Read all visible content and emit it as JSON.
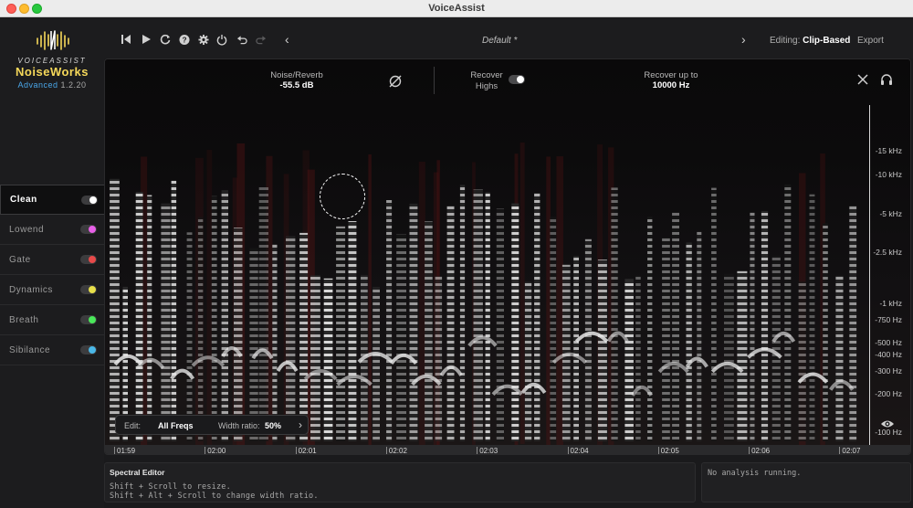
{
  "window": {
    "title": "VoiceAssist"
  },
  "brand": {
    "company": "VOICEASSIST",
    "product": "NoiseWorks",
    "edition": "Advanced",
    "version": "1.2.20"
  },
  "modules": [
    {
      "label": "Clean",
      "active": true,
      "dot": "#ffffff"
    },
    {
      "label": "Lowend",
      "active": false,
      "dot": "#e860e8"
    },
    {
      "label": "Gate",
      "active": false,
      "dot": "#e84a4a"
    },
    {
      "label": "Dynamics",
      "active": false,
      "dot": "#e8e04a"
    },
    {
      "label": "Breath",
      "active": false,
      "dot": "#4ae85a"
    },
    {
      "label": "Sibilance",
      "active": false,
      "dot": "#4ab8e8"
    }
  ],
  "toolbar": {
    "icons": [
      "skip-back-icon",
      "play-icon",
      "loop-icon",
      "help-icon",
      "settings-icon",
      "power-icon",
      "undo-icon",
      "redo-icon"
    ],
    "preset": "Default *",
    "editing_label": "Editing:",
    "editing_mode": "Clip-Based",
    "export_label": "Export"
  },
  "controls": {
    "noise_reverb_label": "Noise/Reverb",
    "noise_reverb_value": "-55.5 dB",
    "recover_highs_label_1": "Recover",
    "recover_highs_label_2": "Highs",
    "recover_highs_on": true,
    "recover_up_to_label": "Recover up to",
    "recover_up_to_value": "10000 Hz"
  },
  "freq_axis": [
    "-15 kHz",
    "-10 kHz",
    "-5 kHz",
    "-2.5 kHz",
    "-1 kHz",
    "-750 Hz",
    "-500 Hz",
    "-400 Hz",
    "-300 Hz",
    "-200 Hz",
    "-100 Hz"
  ],
  "edit_bar": {
    "edit_label": "Edit:",
    "edit_value": "All Freqs",
    "width_label": "Width ratio:",
    "width_value": "50%"
  },
  "timeline": [
    "01:59",
    "02:00",
    "02:01",
    "02:02",
    "02:03",
    "02:04",
    "02:05",
    "02:06",
    "02:07"
  ],
  "spectral_editor": {
    "title": "Spectral Editor",
    "line1": "Shift + Scroll to resize.",
    "line2": "Shift + Alt + Scroll to change width ratio."
  },
  "analysis": {
    "status": "No analysis running."
  },
  "colors": {
    "accent_yellow": "#f6d85a",
    "accent_blue": "#4aa6e8",
    "background": "#0c0b0c"
  }
}
